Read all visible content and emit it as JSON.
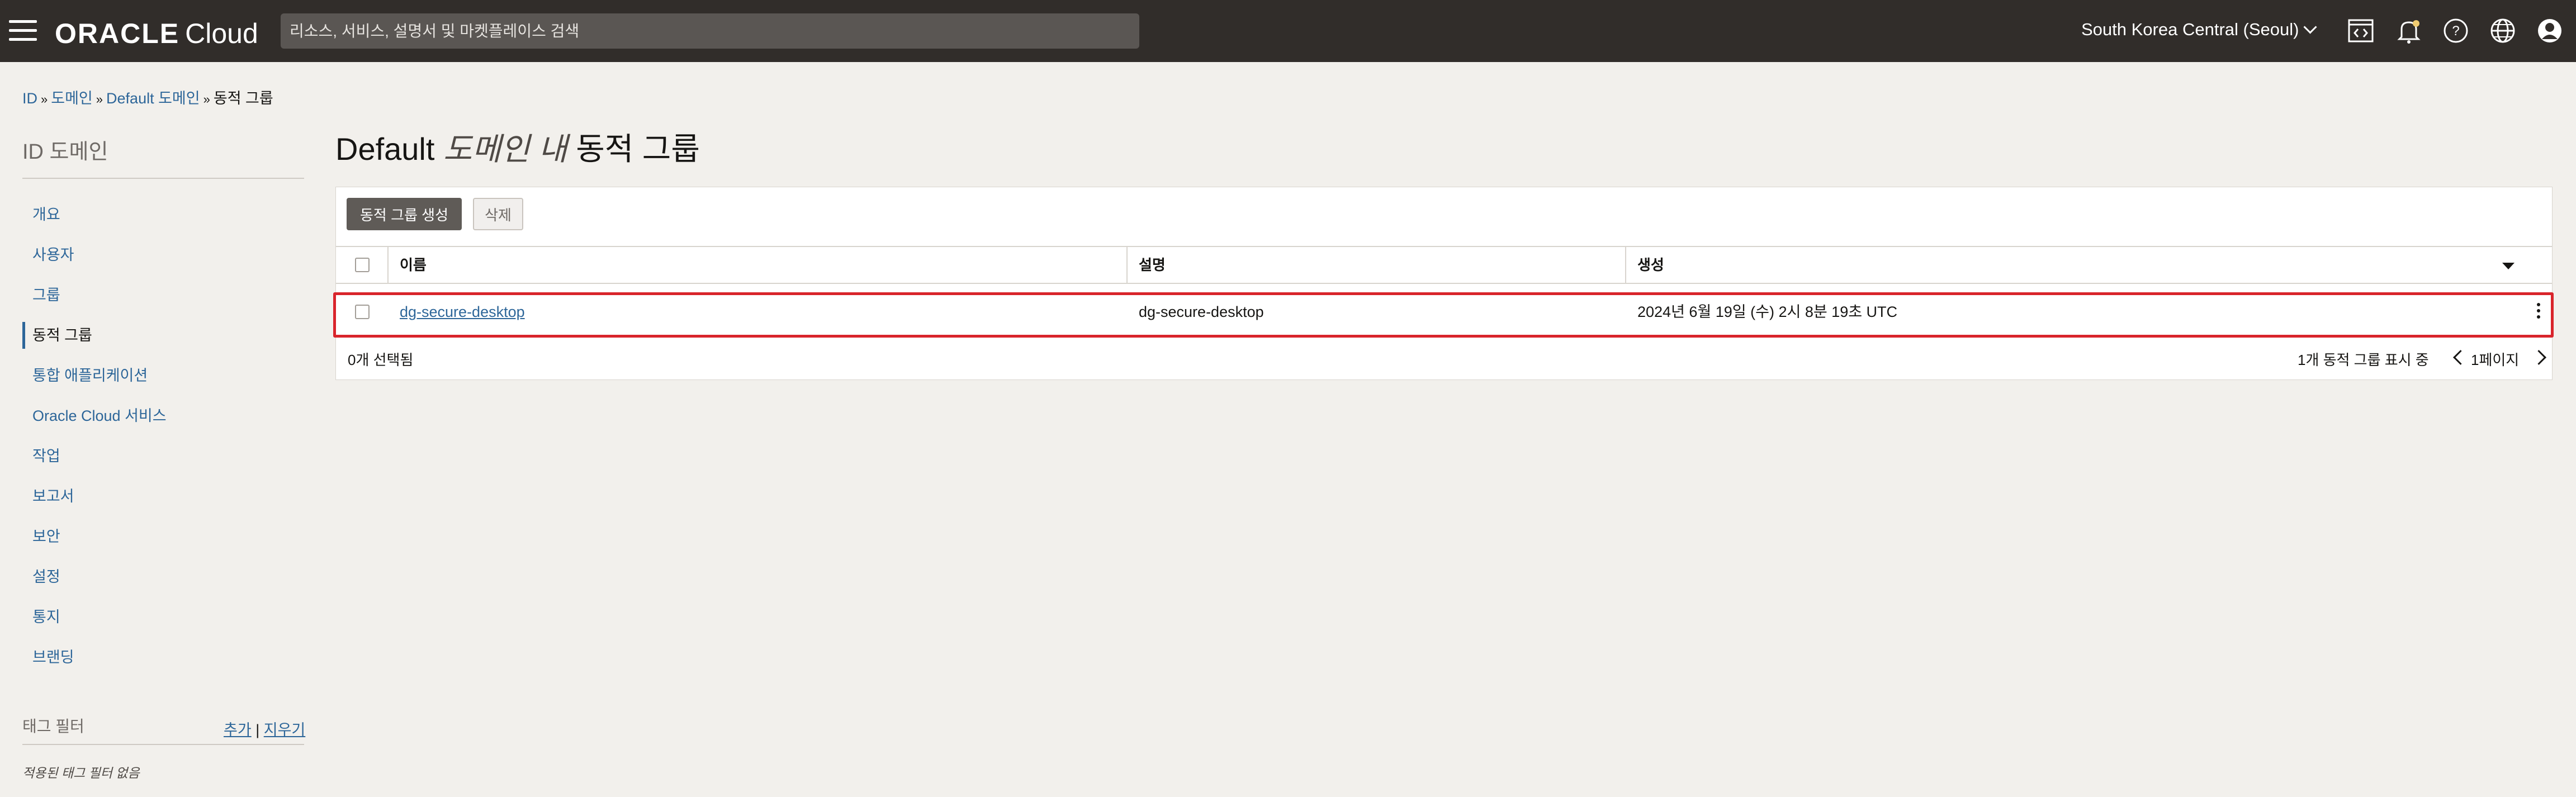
{
  "header": {
    "logo_brand": "ORACLE",
    "logo_product": "Cloud",
    "search_placeholder": "리소스, 서비스, 설명서 및 마켓플레이스 검색",
    "region": "South Korea Central (Seoul)",
    "icons": [
      "menu-icon",
      "code-editor-icon",
      "bell-icon",
      "help-icon",
      "globe-icon",
      "user-profile-icon"
    ]
  },
  "breadcrumb": [
    "ID",
    "도메인",
    "Default 도메인",
    "동적 그룹"
  ],
  "sidebar": {
    "title": "ID 도메인",
    "items": [
      {
        "label": "개요"
      },
      {
        "label": "사용자"
      },
      {
        "label": "그룹"
      },
      {
        "label": "동적 그룹",
        "active": true
      },
      {
        "label": "통합 애플리케이션"
      },
      {
        "label": "Oracle Cloud 서비스"
      },
      {
        "label": "작업"
      },
      {
        "label": "보고서"
      },
      {
        "label": "보안"
      },
      {
        "label": "설정"
      },
      {
        "label": "통지"
      },
      {
        "label": "브랜딩"
      }
    ],
    "tag_filter": {
      "label": "태그 필터",
      "add": "추가",
      "divider": "|",
      "clear": "지우기",
      "empty": "적용된 태그 필터 없음"
    }
  },
  "main": {
    "title_prefix": "Default",
    "title_italic": "도메인 내",
    "title_suffix": "동적 그룹",
    "create_button": "동적 그룹 생성",
    "delete_button": "삭제",
    "columns": {
      "name": "이름",
      "description": "설명",
      "created": "생성"
    },
    "rows": [
      {
        "name": "dg-secure-desktop",
        "description": "dg-secure-desktop",
        "created": "2024년 6월 19일 (수) 2시 8분 19초 UTC"
      }
    ],
    "selected_count": "0개 선택됨",
    "showing": "1개 동적 그룹 표시 중",
    "page": "1페이지"
  },
  "colors": {
    "header_bg": "#312d2a",
    "link": "#2d6699",
    "highlight": "#d9242b",
    "primary_button": "#5f5b57"
  }
}
